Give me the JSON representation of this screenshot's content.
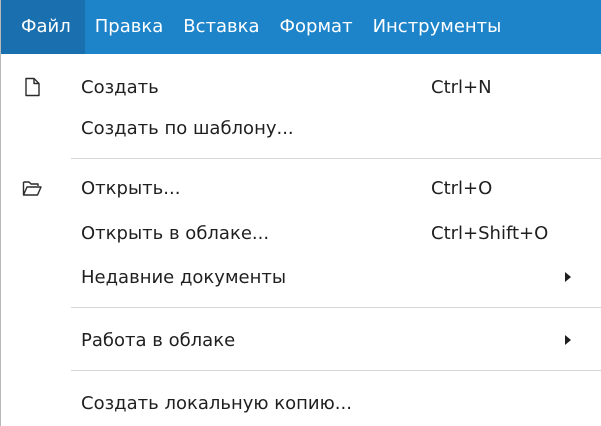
{
  "menubar": {
    "items": [
      "Файл",
      "Правка",
      "Вставка",
      "Формат",
      "Инструменты"
    ]
  },
  "file_menu": {
    "items": [
      {
        "label": "Создать",
        "shortcut": "Ctrl+N",
        "icon": "new-document-icon"
      },
      {
        "label": "Создать по шаблону...",
        "shortcut": ""
      },
      {
        "label": "Открыть...",
        "shortcut": "Ctrl+O",
        "icon": "open-folder-icon"
      },
      {
        "label": "Открыть в облаке...",
        "shortcut": "Ctrl+Shift+O"
      },
      {
        "label": "Недавние документы",
        "submenu": true
      },
      {
        "label": "Работа в облаке",
        "submenu": true
      },
      {
        "label": "Создать локальную копию..."
      }
    ]
  },
  "colors": {
    "menubar_bg": "#1e84c9",
    "menubar_active_bg": "#1a6fae",
    "separator": "#d6d6d6"
  }
}
